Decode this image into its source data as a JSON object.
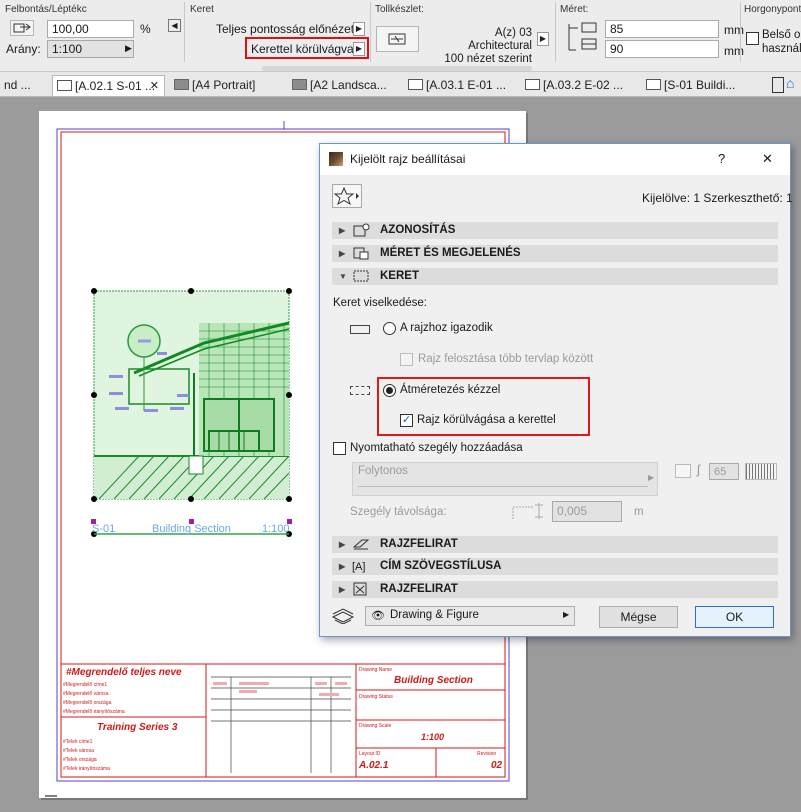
{
  "infobox": {
    "resolution_title": "Felbontás/Léptékc",
    "resolution_value": "100,00",
    "percent": "%",
    "scale_label": "Arány:",
    "scale_value": "1:100",
    "frame_title": "Keret",
    "frame_option1": "Teljes pontosság előnézet",
    "frame_option2": "Kerettel körülvágva",
    "penset_title": "Tollkészlet:",
    "penset_line1": "A(z) 03 Architectural",
    "penset_line2": "100 nézet szerint",
    "size_title": "Méret:",
    "width_value": "85",
    "height_value": "90",
    "unit_mm": "mm",
    "anchor_title": "Horgonypont:",
    "anchor_line1": "Belső or",
    "anchor_line2": "használ"
  },
  "tabs": [
    {
      "label": "nd ..."
    },
    {
      "label": "[A.02.1 S-01 ..."
    },
    {
      "label": "[A4 Portrait]"
    },
    {
      "label": "[A2 Landsca..."
    },
    {
      "label": "[A.03.1 E-01 ..."
    },
    {
      "label": "[A.03.2 E-02 ..."
    },
    {
      "label": "[S-01 Buildi..."
    }
  ],
  "drawing": {
    "marker_name": "S-01",
    "marker_title": "Building Section",
    "marker_scale": "1:100"
  },
  "title_block": {
    "client_name": "#Megrendelő teljes neve",
    "client_lines": [
      "#Megrendelő címe1",
      "#Megrendelő városa",
      "#Megrendelő országa",
      "#Megrendelő irányítószáma"
    ],
    "project_name": "Training Series 3",
    "site_lines": [
      "#Telek címe1",
      "#Telek városa",
      "#Telek országa",
      "#Telek irányítószáma"
    ],
    "drawing_name_label": "Drawing Name",
    "drawing_name": "Building Section",
    "drawing_status_label": "Drawing Status",
    "drawing_scale_label": "Drawing Scale",
    "drawing_scale": "1:100",
    "layout_id_label": "Layout ID",
    "layout_id": "A.02.1",
    "revision_label": "Revision",
    "revision": "02"
  },
  "dialog": {
    "title": "Kijelölt rajz beállításai",
    "help": "?",
    "close": "✕",
    "selected_info": "Kijelölve: 1 Szerkeszthető: 1",
    "groups": {
      "identification": "AZONOSÍTÁS",
      "size_appearance": "MÉRET ÉS MEGJELENÉS",
      "frame": "KERET",
      "drawing_title": "RAJZFELIRAT",
      "title_text_style": "CÍM SZÖVEGSTÍLUSA",
      "drawing_title2": "RAJZFELIRAT"
    },
    "frame_behavior_label": "Keret viselkedése:",
    "radio_fit": "A rajzhoz igazodik",
    "check_split": "Rajz felosztása több tervlap között",
    "radio_manual": "Átméretezés kézzel",
    "check_clip": "Rajz körülvágása a kerettel",
    "check_printable": "Nyomtatható szegély hozzáadása",
    "line_type": "Folytonos",
    "pen_value": "65",
    "margin_label": "Szegély távolsága:",
    "margin_value": "0,005",
    "margin_unit": "m",
    "footer_dropdown": "Drawing & Figure",
    "cancel": "Mégse",
    "ok": "OK"
  },
  "colors": {
    "accent_red": "#d01818",
    "drawing_green": "#1a9a2a",
    "dialog_border": "#6a96cf",
    "ok_border": "#2a6fd6"
  }
}
